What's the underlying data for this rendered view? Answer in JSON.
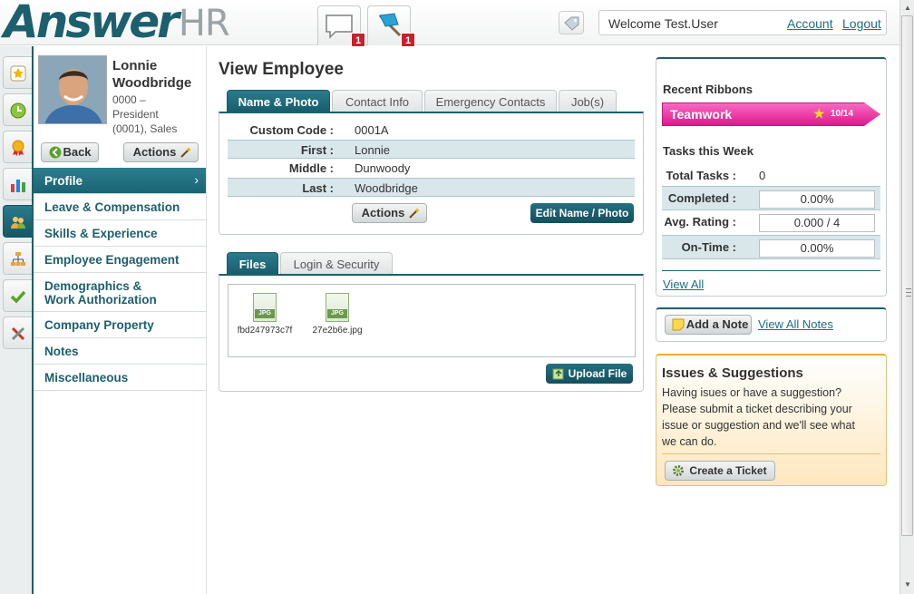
{
  "header": {
    "logo_bold": "Answer",
    "logo_light": "HR",
    "messages_badge": "1",
    "flags_badge": "1",
    "welcome": "Welcome Test.User",
    "account_link": "Account",
    "logout_link": "Logout"
  },
  "employee": {
    "first": "Lonnie",
    "last": "Woodbridge",
    "info_line1": "0000 –",
    "info_line2": "President",
    "info_line3": "(0001), Sales",
    "back_label": "Back",
    "actions_label": "Actions"
  },
  "nav": {
    "items": [
      {
        "label": "Profile"
      },
      {
        "label": "Leave & Compensation"
      },
      {
        "label": "Skills & Experience"
      },
      {
        "label": "Employee Engagement"
      },
      {
        "label": "Demographics &",
        "label2": "Work Authorization"
      },
      {
        "label": "Company Property"
      },
      {
        "label": "Notes"
      },
      {
        "label": "Miscellaneous"
      }
    ]
  },
  "main": {
    "title": "View Employee",
    "tabs": [
      "Name & Photo",
      "Contact Info",
      "Emergency Contacts",
      "Job(s)"
    ],
    "fields": [
      {
        "label": "Custom Code :",
        "value": "0001A"
      },
      {
        "label": "First :",
        "value": "Lonnie"
      },
      {
        "label": "Middle :",
        "value": "Dunwoody"
      },
      {
        "label": "Last :",
        "value": "Woodbridge"
      }
    ],
    "actions_label": "Actions",
    "edit_label": "Edit Name / Photo",
    "file_tabs": [
      "Files",
      "Login & Security"
    ],
    "files": [
      {
        "type": "JPG",
        "name": "fbd247973c7f"
      },
      {
        "type": "JPG",
        "name": "27e2b6e.jpg"
      }
    ],
    "upload_label": "Upload File"
  },
  "right": {
    "ribbons_title": "Recent Ribbons",
    "ribbon_name": "Teamwork",
    "ribbon_count": "10/14",
    "tasks_title": "Tasks this Week",
    "total_label": "Total Tasks :",
    "total_value": "0",
    "completed_label": "Completed :",
    "completed_value": "0.00%",
    "rating_label": "Avg. Rating :",
    "rating_value": "0.000 / 4",
    "ontime_label": "On-Time :",
    "ontime_value": "0.00%",
    "view_all": "View All",
    "add_note": "Add a Note",
    "view_notes": "View All Notes",
    "issues_title": "Issues & Suggestions",
    "issues_text1": "Having isues or have a suggestion?",
    "issues_text2": "Please submit a ticket describing your",
    "issues_text3": "issue or suggestion and we'll see what",
    "issues_text4": "we can do.",
    "ticket_label": "Create a Ticket"
  },
  "colors": {
    "brand": "#1d5f6d",
    "ribbon": "#e0198e",
    "badge": "#c8202c"
  },
  "icons": [
    "messages-icon",
    "flag-icon",
    "tag-icon",
    "star-icon",
    "clock-icon",
    "award-icon",
    "chart-icon",
    "people-icon",
    "org-chart-icon",
    "check-icon",
    "tools-icon",
    "wand-icon",
    "back-arrow-icon",
    "chevron-right-icon",
    "jpg-file-icon",
    "upload-icon",
    "sticky-note-icon",
    "gear-icon"
  ]
}
